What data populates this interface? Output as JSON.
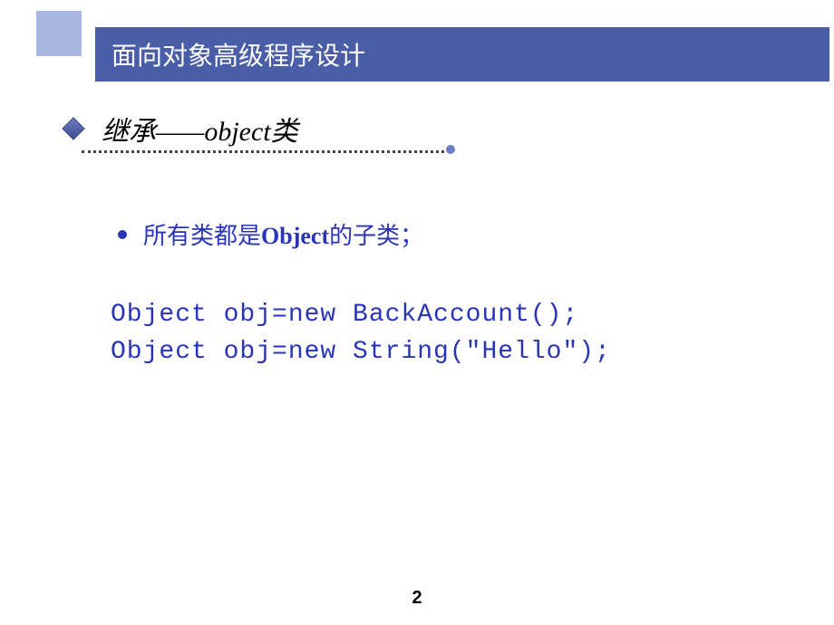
{
  "header": {
    "title": "面向对象高级程序设计"
  },
  "subtitle": {
    "text": "继承——object类"
  },
  "bullet": {
    "prefix": "所有类都是",
    "bold": "Object",
    "suffix": "的子类；"
  },
  "code": {
    "line1": "Object obj=new BackAccount();",
    "line2": "Object obj=new String(\"Hello\");"
  },
  "page_number": "2"
}
